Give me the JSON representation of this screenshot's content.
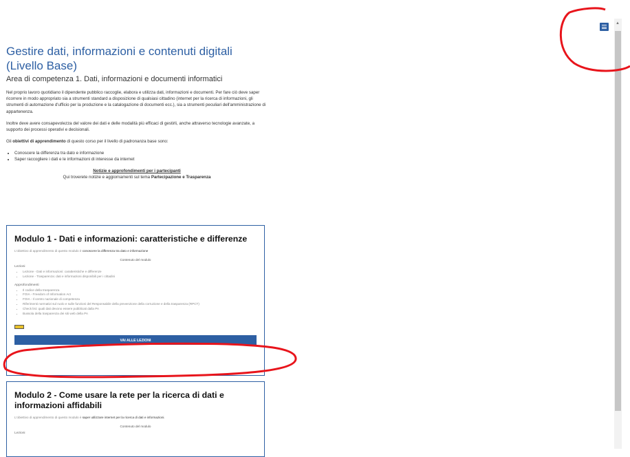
{
  "page": {
    "title": "Gestire dati, informazioni e contenuti digitali (Livello Base)",
    "subtitle": "Area di competenza 1. Dati, informazioni e documenti informatici",
    "paragraph1": "Nel proprio lavoro quotidiano il dipendente pubblico raccoglie, elabora e utilizza dati, informazioni e documenti. Per fare ciò deve saper ricorrere in modo appropriato sia a strumenti standard a disposizione di qualsiasi cittadino (internet per la ricerca di informazioni, gli strumenti di automazione d'ufficio per la produzione e la catalogazione di documenti ecc.), sia a strumenti peculiari dell'amministrazione di appartenenza.",
    "paragraph2": "Inoltre deve avere consapevolezza del valore dei dati e delle modalità più efficaci di gestirli, anche attraverso tecnologie avanzate, a supporto dei processi operativi e decisionali.",
    "objectives_bold": "obiettivi di apprendimento",
    "objectives_pre": "Gli ",
    "objectives_post": " di questo corso per il livello di padronanza base sono:",
    "objectives": [
      "Conoscere la differenza tra dato e informazione",
      "Saper raccogliere i dati e le informazioni di interesse da internet"
    ],
    "news_link": "Notizie e approfondimenti per i partecipanti",
    "news_text_pre": "Qui troverete notizie e aggiornamenti sul tema ",
    "news_text_bold": "Partecipazione e Trasparenza"
  },
  "module1": {
    "title": "Modulo 1 - Dati e informazioni: caratteristiche e differenze",
    "intro_pre": "L'obiettivo di apprendimento di questo modulo è ",
    "intro_bold": "conoscere la differenza tra dato e informazione",
    "content_label": "Contenuto del modulo",
    "lessons_label": "Lezioni",
    "lessons": [
      "Lezione - Dati e informazioni: caratteristiche e differenze",
      "Lezione - Trasparenza: dati e informazioni disponibili per i cittadini"
    ],
    "deepening_label": "Approfondimenti",
    "deepening": [
      "Il codice della trasparenza",
      "FOIA - Freedom of Information Act",
      "FOIA - Il centro nazionale di competenza",
      "Riferimenti normativi sul ruolo e sulle funzioni del Responsabile della prevenzione della corruzione e della trasparenza (RPCT)",
      "Check list: quali dati devono essere pubblicati dalla PA",
      "Bussola della trasparenza dei siti web della PA"
    ],
    "button": "VAI ALLE LEZIONI"
  },
  "module2": {
    "title": "Modulo 2 - Come usare la rete per la ricerca di dati e informazioni affidabili",
    "intro_pre": "L'obiettivo di apprendimento di questo modulo è ",
    "intro_bold": "saper utilizzare internet per la ricerca di dati e informazioni",
    "intro_post": ".",
    "content_label": "Contenuto del modulo",
    "lessons_label": "Lezioni"
  },
  "colors": {
    "accent": "#2d5fa3",
    "annotation": "#e8141b"
  },
  "icons": {
    "toc": "list-icon",
    "scroll_up": "chevron-up-icon"
  }
}
